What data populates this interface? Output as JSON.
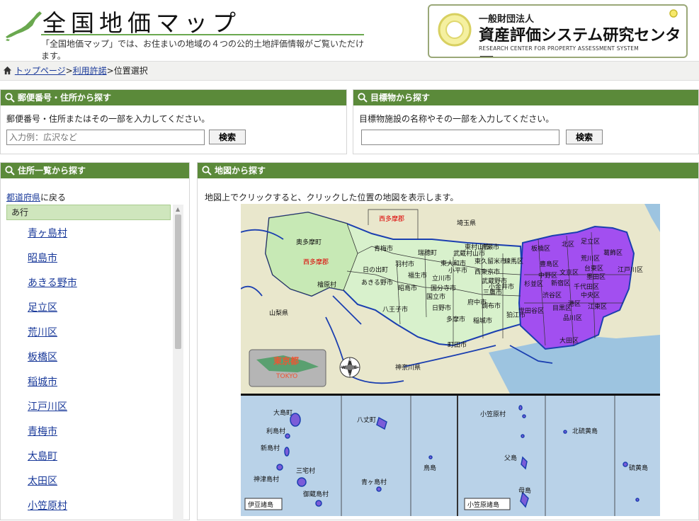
{
  "header": {
    "title": "全国地価マップ",
    "tagline": "「全国地価マップ」では、お住まいの地域の４つの公的土地評価情報がご覧いただけます。",
    "org_small": "一般財団法人",
    "org_name": "資産評価システム研究センター",
    "org_en": "RESEARCH CENTER FOR PROPERTY ASSESSMENT SYSTEM"
  },
  "breadcrumb": {
    "home_icon": "house-icon",
    "top": "トップページ",
    "sep1": ">",
    "terms": "利用許諾",
    "sep2": ">",
    "current": "位置選択"
  },
  "postal_search": {
    "heading": "郵便番号・住所から探す",
    "hint": "郵便番号・住所またはその一部を入力してください。",
    "placeholder": "入力例：広沢など",
    "button": "検索"
  },
  "landmark_search": {
    "heading": "目標物から探す",
    "hint": "目標物施設の名称やその一部を入力してください。",
    "placeholder": "",
    "button": "検索"
  },
  "address_list": {
    "heading": "住所一覧から探す",
    "back_link": "都道府県",
    "back_suffix": "に戻る",
    "group": "あ行",
    "items": [
      "青ヶ島村",
      "昭島市",
      "あきる野市",
      "足立区",
      "荒川区",
      "板橋区",
      "稲城市",
      "江戸川区",
      "青梅市",
      "大島町",
      "太田区",
      "小笠原村"
    ]
  },
  "map_search": {
    "heading": "地図から探す",
    "hint": "地図上でクリックすると、クリックした位置の地図を表示します。",
    "badge_ja": "東京都",
    "badge_en": "TOKYO",
    "compass": [
      "N",
      "E",
      "S",
      "W"
    ],
    "labels": {
      "nishitama_top": "西多摩郡",
      "okutama": "奥多摩町",
      "nishitama": "西多摩郡",
      "hinohara": "檜原村",
      "ome": "青梅市",
      "hinode": "日の出町",
      "akiruno": "あきる野市",
      "hamura": "羽村市",
      "mizuho": "瑞穂町",
      "musashimurayama": "武蔵村山市",
      "higashiyamato": "東大和市",
      "higashimurayama": "東村山市",
      "kiyose": "清瀬市",
      "fussa": "福生市",
      "tachikawa": "立川市",
      "akishima": "昭島市",
      "kodaira": "小平市",
      "higashikurume": "東久留米市",
      "nishitokyo": "西東京市",
      "koganei": "小金井市",
      "kokubunji": "国分寺市",
      "kunitachi": "国立市",
      "fuchu": "府中市",
      "hino": "日野市",
      "hachioji": "八王子市",
      "tama": "多摩市",
      "inagi": "稲城市",
      "machida": "町田市",
      "musashino": "武蔵野市",
      "mitaka": "三鷹市",
      "chofu": "調布市",
      "komae": "狛江市",
      "nerima": "練馬区",
      "itabashi": "板橋区",
      "kita": "北区",
      "adachi": "足立区",
      "katsushika": "葛飾区",
      "arakawa": "荒川区",
      "toshima": "豊島区",
      "nakano": "中野区",
      "suginami": "杉並区",
      "shinjuku": "新宿区",
      "bunkyo": "文京区",
      "taito": "台東区",
      "sumida": "墨田区",
      "edogawa": "江戸川区",
      "chiyoda": "千代田区",
      "chuo": "中央区",
      "shibuya": "渋谷区",
      "minato": "港区",
      "koto": "江東区",
      "setagaya": "世田谷区",
      "meguro": "目黒区",
      "shinagawa": "品川区",
      "ota": "大田区",
      "saitama": "埼玉県",
      "yamanashi": "山梨県",
      "kanagawa": "神奈川県",
      "oshima": "大島町",
      "toshimamura": "利島村",
      "niijima": "新島村",
      "kozushima": "神津島村",
      "miyake": "三宅村",
      "mikurajima": "御蔵島村",
      "izu": "伊豆諸島",
      "hachijo": "八丈町",
      "aogashima": "青ヶ島村",
      "torishima": "鳥島",
      "ogasawara": "小笠原村",
      "kitaiwo": "北硫黄島",
      "chichijima": "父島",
      "hahajima": "母島",
      "iwoto": "硫黄島",
      "ogasawara_islands": "小笠原諸島"
    }
  }
}
